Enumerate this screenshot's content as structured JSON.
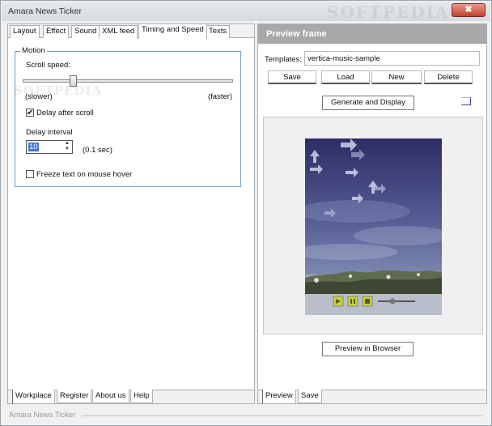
{
  "window": {
    "title": "Amara News Ticker",
    "close_symbol": "✖"
  },
  "watermark": "SOFTPEDIA",
  "left_tabs": [
    "Layout",
    "Effect",
    "Sound",
    "XML feed",
    "Timing and Speed",
    "Texts"
  ],
  "active_left_tab": "Timing and Speed",
  "motion": {
    "group_label": "Motion",
    "scroll_speed_label": "Scroll speed:",
    "scroll_speed_fraction": 0.23,
    "slower_label": "(slower)",
    "faster_label": "(faster)",
    "delay_after_scroll_label": "Delay after scroll",
    "delay_after_scroll_checked": true,
    "delay_interval_label": "Delay interval",
    "delay_interval_value": "10",
    "delay_unit": "(0.1 sec)",
    "freeze_label": "Freeze text on mouse hover",
    "freeze_checked": false
  },
  "left_bottom_tabs": [
    "Workplace",
    "Register",
    "About us",
    "Help"
  ],
  "preview": {
    "header": "Preview frame",
    "templates_label": "Templates:",
    "template_value": "vertica-music-sample",
    "buttons": {
      "save": "Save",
      "load": "Load",
      "new": "New",
      "delete": "Delete"
    },
    "generate_label": "Generate and Display",
    "browser_label": "Preview in Browser"
  },
  "right_bottom_tabs": [
    "Preview",
    "Save"
  ],
  "status_text": "Amara News Ticker",
  "colors": {
    "header_bg": "#a6a8aa",
    "group_border": "#6aa0cc",
    "selection": "#3f77d6"
  }
}
